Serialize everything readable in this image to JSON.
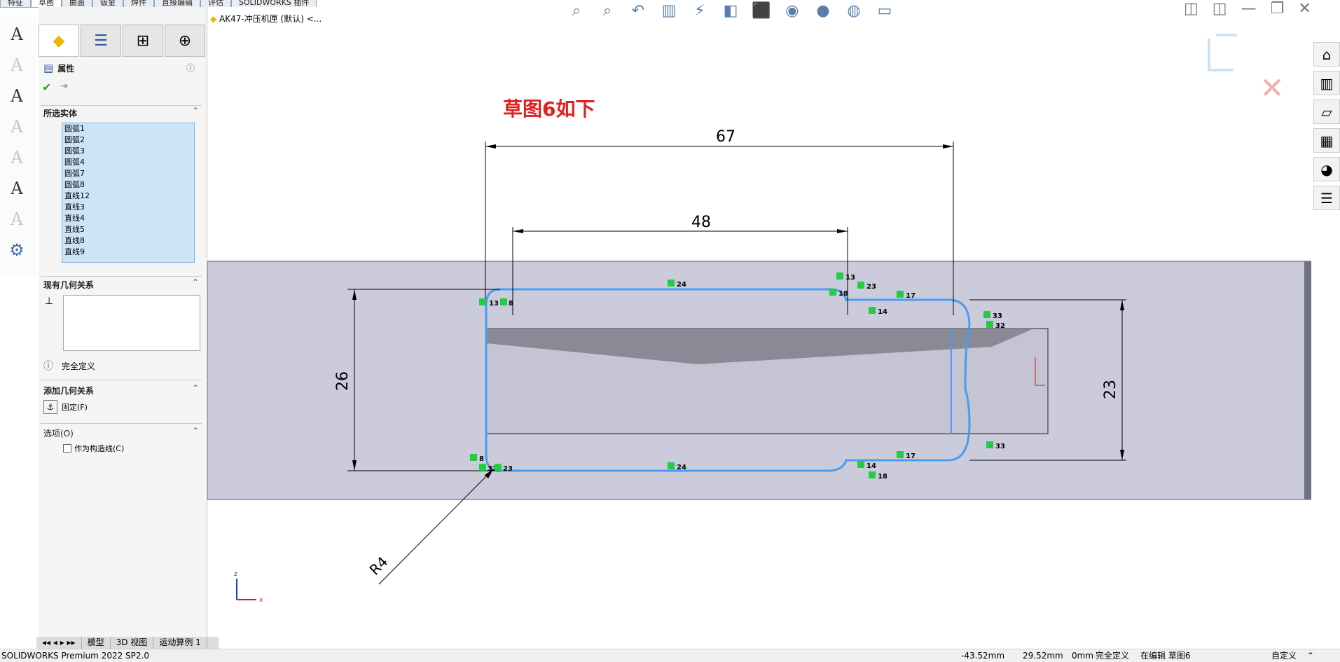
{
  "top_tabs": [
    "特征",
    "草图",
    "曲面",
    "钣金",
    "焊件",
    "直接编辑",
    "评估",
    "SOLIDWORKS 插件"
  ],
  "breadcrumb": "AK47-冲压机匣 (默认) <...",
  "panel": {
    "title": "属性",
    "selected_entities_title": "所选实体",
    "selected_entities": [
      "圆弧1",
      "圆弧2",
      "圆弧3",
      "圆弧4",
      "圆弧7",
      "圆弧8",
      "直线12",
      "直线3",
      "直线4",
      "直线5",
      "直线8",
      "直线9"
    ],
    "existing_relations_title": "现有几何关系",
    "status": "完全定义",
    "add_relations_title": "添加几何关系",
    "fix_label": "固定(F)",
    "options_title": "选项(O)",
    "construction_label": "作为构造线(C)"
  },
  "annotation": "草图6如下",
  "dimensions": {
    "d67": "67",
    "d48": "48",
    "d26": "26",
    "d23": "23",
    "r4": "R4"
  },
  "relation_tags": [
    "13",
    "8",
    "24",
    "13",
    "23",
    "18",
    "14",
    "17",
    "33",
    "32",
    "8",
    "32",
    "23",
    "24",
    "14",
    "18",
    "17",
    "33"
  ],
  "axis": {
    "z": "z",
    "x": "x"
  },
  "bottom_tabs": [
    "模型",
    "3D 视图",
    "运动算例 1"
  ],
  "status_bar": {
    "app": "SOLIDWORKS Premium 2022 SP2.0",
    "x": "-43.52mm",
    "y": "29.52mm",
    "z": "0mm",
    "define": "完全定义",
    "editing": "在编辑 草图6",
    "custom": "自定义"
  },
  "colors": {
    "sketch": "#4a9cf0",
    "relation": "#22cc44",
    "annotation": "#e02020",
    "part": "#c8c8d8"
  }
}
